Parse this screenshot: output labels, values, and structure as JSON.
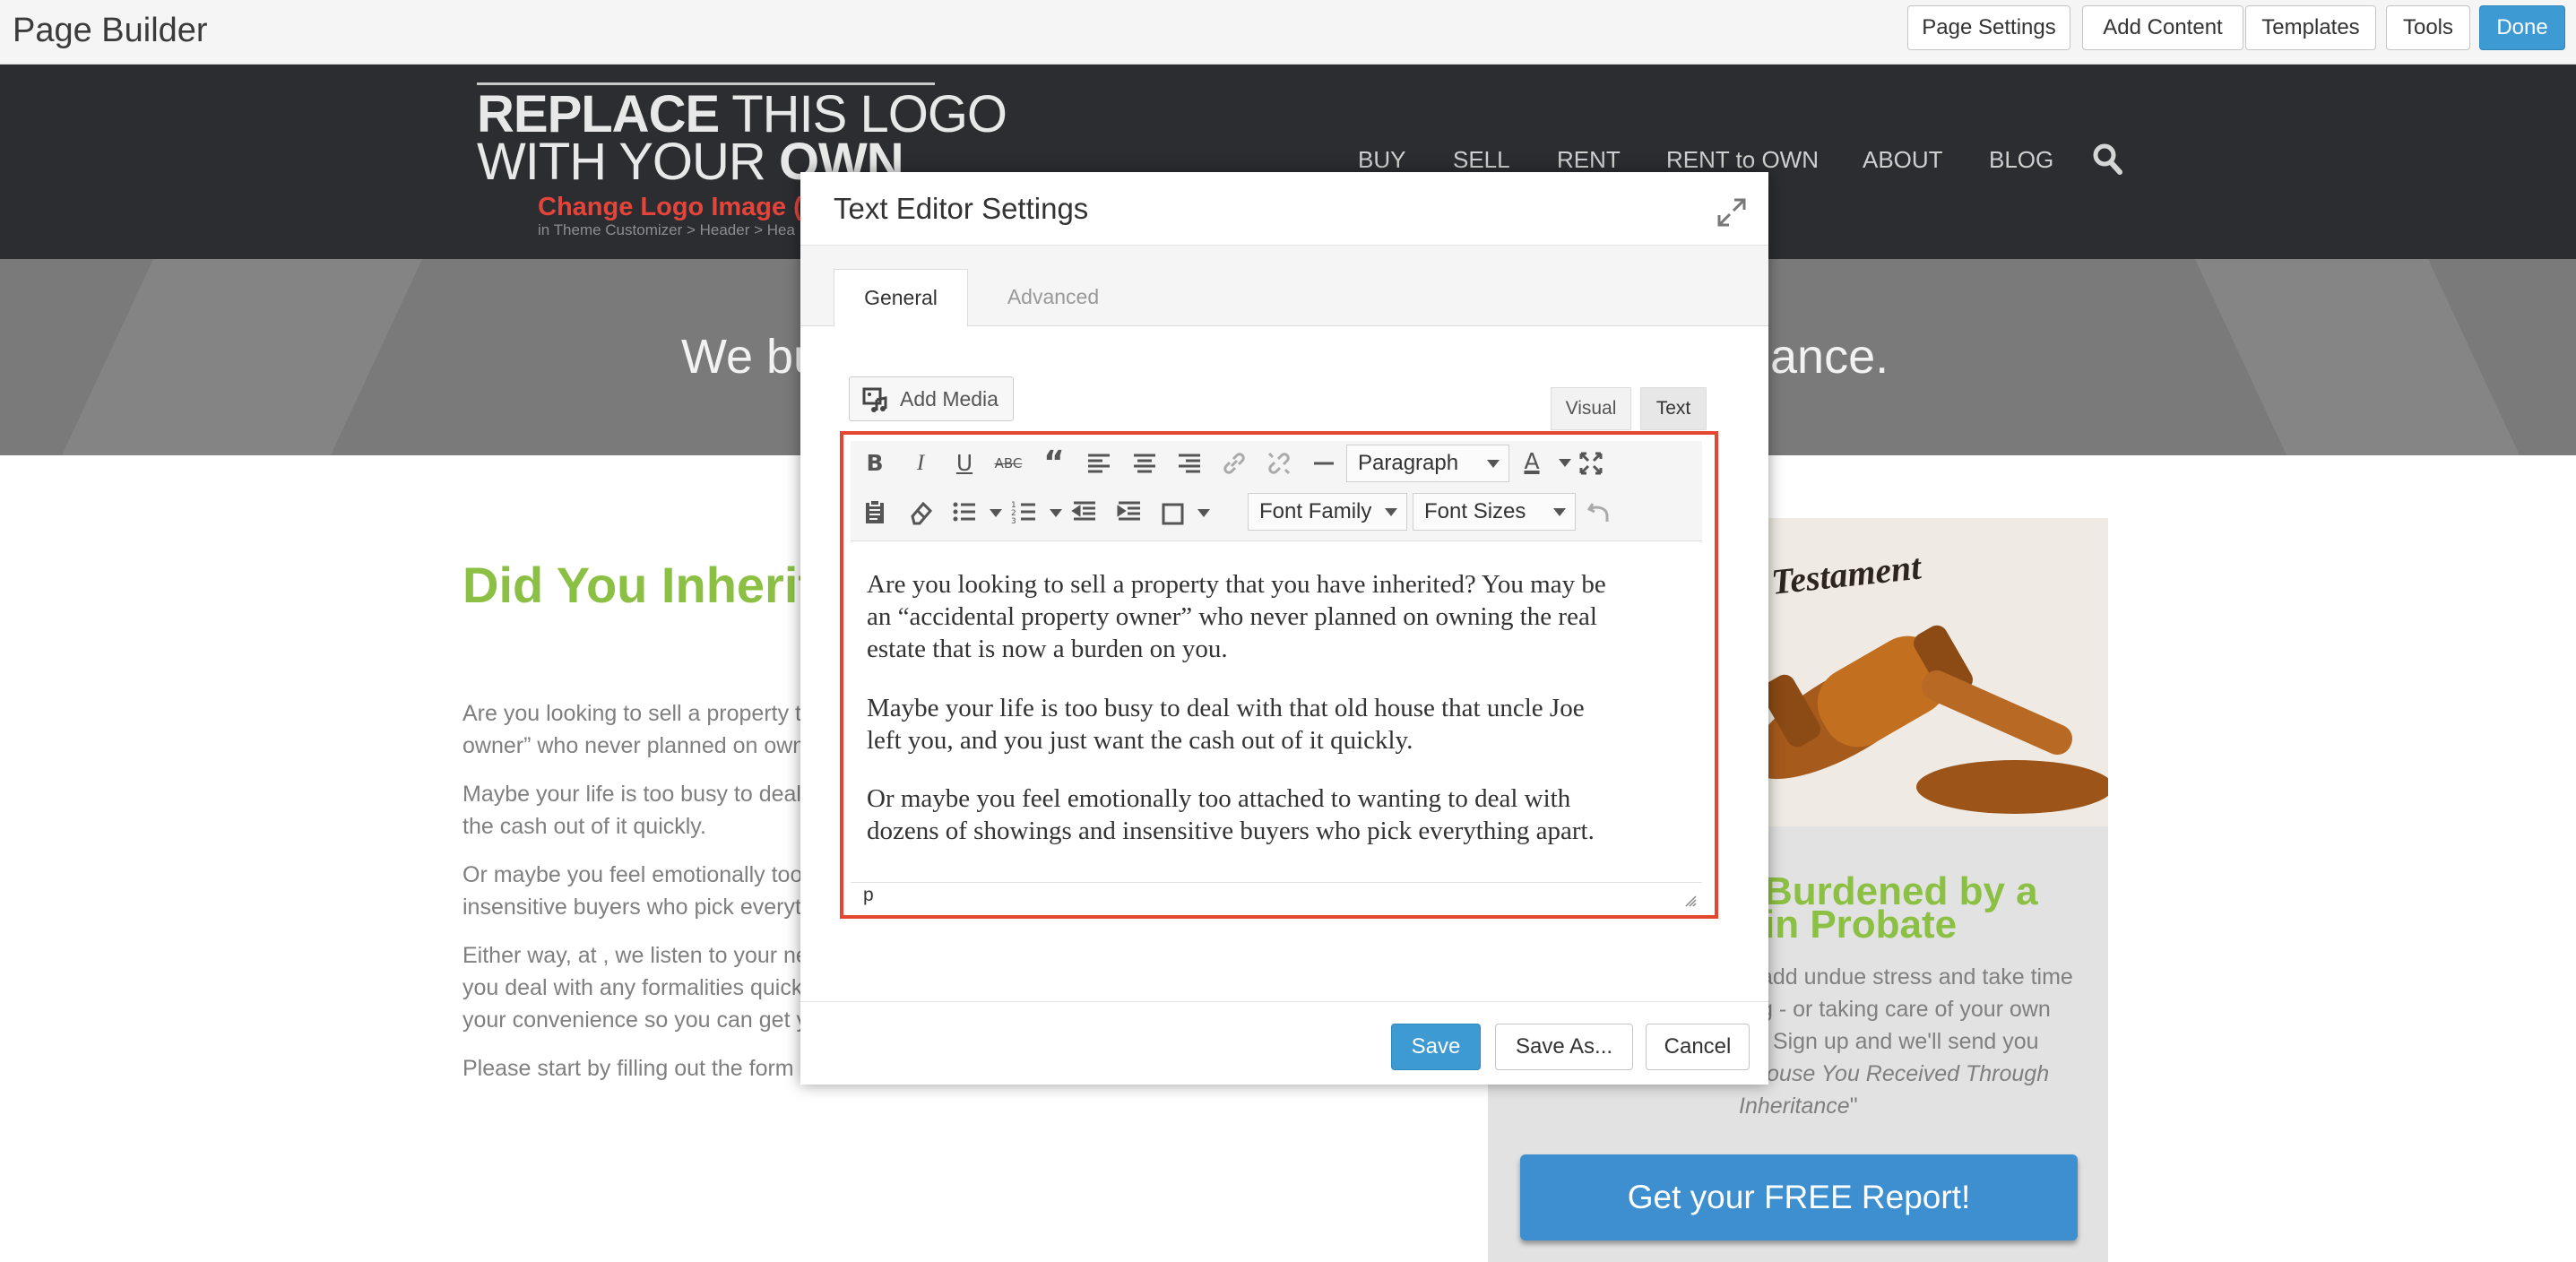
{
  "builder": {
    "title": "Page Builder",
    "buttons": [
      "Page Settings",
      "Add Content",
      "Templates",
      "Tools",
      "Done"
    ]
  },
  "site": {
    "logo_line1_bold": "REPLACE",
    "logo_line1_rest": " THIS LOGO",
    "logo_line2_rest": "WITH YOUR ",
    "logo_line2_bold": "OWN",
    "logo_change": "Change Logo Image (R",
    "logo_sub": "in Theme Customizer  >  Header  >  Hea",
    "nav": [
      "BUY",
      "SELL",
      "RENT",
      "RENT to OWN",
      "ABOUT",
      "BLOG"
    ],
    "hero_left": "We bu",
    "hero_right": "ance."
  },
  "content": {
    "heading": "Did You Inherit",
    "paragraphs": [
      "Are you looking to sell a property t",
      "owner” who never planned on own",
      "Maybe your life is too busy to deal",
      "the cash out of it quickly.",
      "Or maybe you feel emotionally too",
      "insensitive buyers who pick everyt",
      "Either way, at , we listen to your ne",
      "you deal with any formalities quick",
      "your convenience so you can get y",
      "Please start by filling out the form"
    ]
  },
  "sidebar": {
    "img_text": "d Testament",
    "heading_line1": "Burdened by a",
    "heading_line2": "in Probate",
    "text_lines": [
      "add undue stress and take time",
      "g - or taking care of your own",
      "! Sign up and we'll send you"
    ],
    "italic_line1": "House You Received Through",
    "italic_line2": "Inheritance",
    "quote_end": "\"",
    "cta": "Get your FREE Report!"
  },
  "modal": {
    "title": "Text Editor Settings",
    "tabs": [
      "General",
      "Advanced"
    ],
    "add_media": "Add Media",
    "editor_tabs": [
      "Visual",
      "Text"
    ],
    "format_select": "Paragraph",
    "font_family": "Font Family",
    "font_sizes": "Font Sizes",
    "body_lines": [
      "Are you looking to sell a property that you have inherited? You may be",
      "an “accidental property owner” who never planned on owning the real",
      "estate that is now a burden on you.",
      "Maybe your life is too busy to deal with that old house that uncle Joe",
      "left you, and you just want the cash out of it quickly.",
      "Or maybe you feel emotionally too attached to wanting to deal with",
      "dozens of showings and insensitive buyers who pick everything apart."
    ],
    "status_path": "p",
    "footer_buttons": [
      "Save",
      "Save As...",
      "Cancel"
    ]
  },
  "colors": {
    "accent_blue": "#3d9ad3",
    "highlight_red": "#e4462f",
    "heading_green": "#8cc044",
    "header_dark": "#2b2d31"
  }
}
